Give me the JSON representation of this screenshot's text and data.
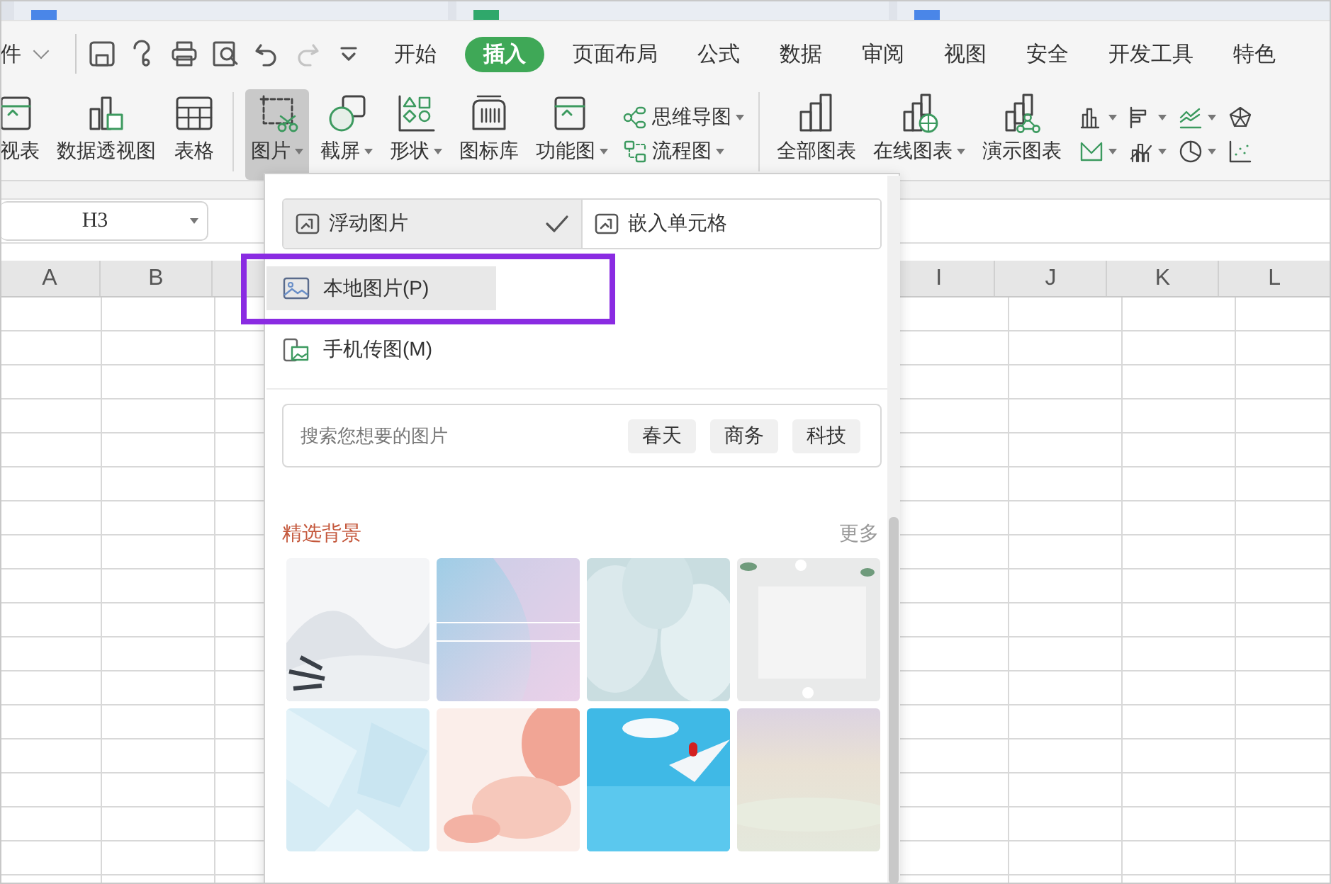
{
  "document_tabs": [
    {
      "color": "#4a86e8"
    },
    {
      "color": "#2fa86b"
    },
    {
      "color": "#4a86e8"
    }
  ],
  "menu": {
    "file_label": "件",
    "quick_access": [
      {
        "disabled": false
      },
      {
        "disabled": false
      },
      {
        "disabled": false
      },
      {
        "disabled": false
      },
      {
        "disabled": false
      },
      {
        "disabled": true
      },
      {
        "disabled": false
      }
    ],
    "tabs": [
      {
        "label": "开始",
        "selected": false
      },
      {
        "label": "插入",
        "selected": true
      },
      {
        "label": "页面布局",
        "selected": false
      },
      {
        "label": "公式",
        "selected": false
      },
      {
        "label": "数据",
        "selected": false
      },
      {
        "label": "审阅",
        "selected": false
      },
      {
        "label": "视图",
        "selected": false
      },
      {
        "label": "安全",
        "selected": false
      },
      {
        "label": "开发工具",
        "selected": false
      },
      {
        "label": "特色",
        "selected": false
      }
    ]
  },
  "ribbon": [
    {
      "kind": "large",
      "label": "视表",
      "caret": false,
      "selected": false
    },
    {
      "kind": "large",
      "label": "数据透视图",
      "caret": false,
      "selected": false
    },
    {
      "kind": "large",
      "label": "表格",
      "caret": false,
      "selected": false
    },
    {
      "kind": "separator"
    },
    {
      "kind": "large",
      "label": "图片",
      "caret": true,
      "selected": true
    },
    {
      "kind": "large",
      "label": "截屏",
      "caret": true,
      "selected": false
    },
    {
      "kind": "large",
      "label": "形状",
      "caret": true,
      "selected": false
    },
    {
      "kind": "large",
      "label": "图标库",
      "caret": false,
      "selected": false
    },
    {
      "kind": "large",
      "label": "功能图",
      "caret": true,
      "selected": false
    },
    {
      "kind": "stack",
      "items": [
        {
          "label": "思维导图",
          "caret": true
        },
        {
          "label": "流程图",
          "caret": true
        }
      ]
    },
    {
      "kind": "separator"
    },
    {
      "kind": "large",
      "label": "全部图表",
      "caret": false,
      "selected": false
    },
    {
      "kind": "large",
      "label": "在线图表",
      "caret": true,
      "selected": false
    },
    {
      "kind": "large",
      "label": "演示图表",
      "caret": false,
      "selected": false
    },
    {
      "kind": "chart-grid"
    }
  ],
  "name_box": {
    "value": "H3"
  },
  "columns_left": [
    "A",
    "B"
  ],
  "columns_right": [
    "I",
    "J",
    "K",
    "L"
  ],
  "picture_menu": {
    "modes": [
      {
        "label": "浮动图片",
        "selected": true
      },
      {
        "label": "嵌入单元格",
        "selected": false
      }
    ],
    "items": [
      {
        "label": "本地图片(P)",
        "selected": true
      },
      {
        "label": "手机传图(M)",
        "selected": false
      }
    ],
    "search": {
      "placeholder": "搜索您想要的图片",
      "tags": [
        "春天",
        "商务",
        "科技"
      ]
    },
    "section": {
      "title": "精选背景",
      "more": "更多"
    }
  }
}
